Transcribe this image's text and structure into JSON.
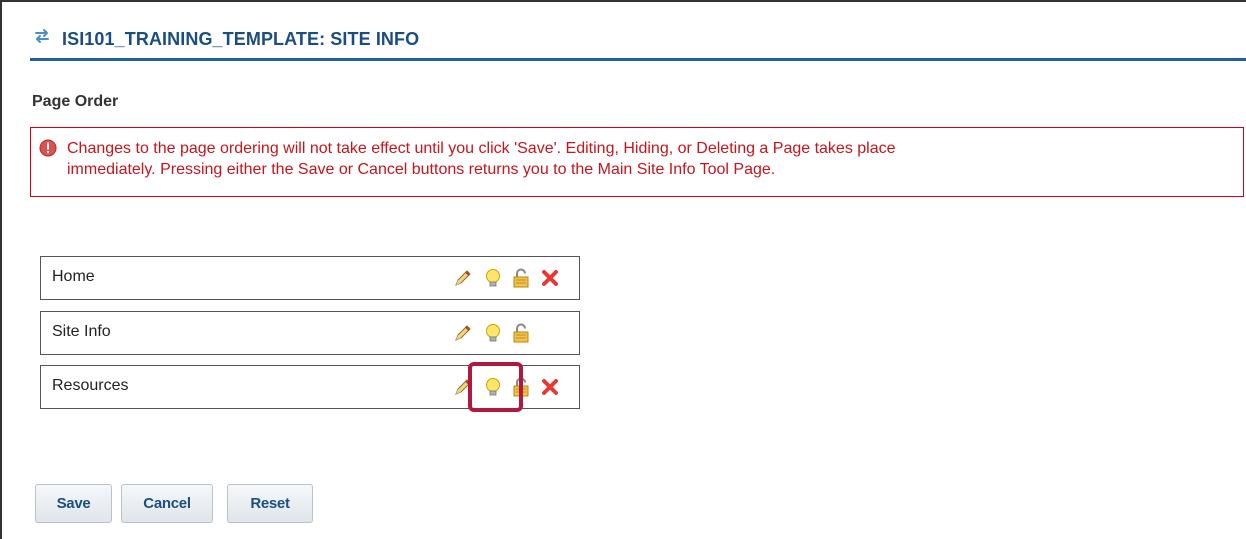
{
  "header": {
    "title": "ISI101_TRAINING_TEMPLATE: SITE INFO",
    "icon": "reorder-arrows-icon",
    "color": "#1a4d80"
  },
  "section_title": "Page Order",
  "alert": {
    "icon": "exclamation-circle-icon",
    "line1": "Changes to the page ordering will not take effect until you click 'Save'. Editing, Hiding, or Deleting a Page takes place",
    "line2": "immediately. Pressing either the Save or Cancel buttons returns you to the Main Site Info Tool Page.",
    "color": "#c4161c"
  },
  "pages": [
    {
      "label": "Home",
      "icons": [
        "pencil-icon",
        "lightbulb-icon",
        "unlock-icon",
        "delete-x-icon"
      ]
    },
    {
      "label": "Site Info",
      "icons": [
        "pencil-icon",
        "lightbulb-icon",
        "unlock-icon"
      ]
    },
    {
      "label": "Resources",
      "icons": [
        "pencil-icon",
        "lightbulb-icon",
        "unlock-icon",
        "delete-x-icon"
      ]
    }
  ],
  "highlight_color": "#b01840",
  "buttons": {
    "save": "Save",
    "cancel": "Cancel",
    "reset": "Reset"
  }
}
